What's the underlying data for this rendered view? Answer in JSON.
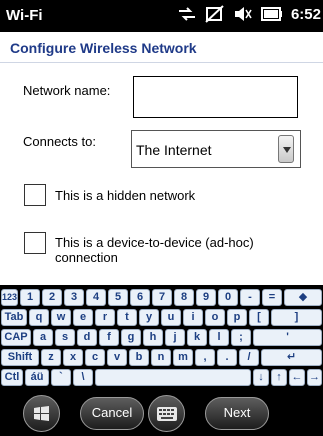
{
  "status_bar": {
    "title": "Wi-Fi",
    "time": "6:52"
  },
  "header": {
    "title": "Configure Wireless Network"
  },
  "form": {
    "network_name_label": "Network name:",
    "network_name_value": "",
    "connects_to_label": "Connects to:",
    "connects_to_value": "The Internet",
    "hidden_network_label": "This is a hidden network",
    "adhoc_label_line1": "This is a device-to-device (ad-hoc)",
    "adhoc_label_line2": "connection"
  },
  "keyboard": {
    "row1": [
      "123",
      "1",
      "2",
      "3",
      "4",
      "5",
      "6",
      "7",
      "8",
      "9",
      "0",
      "-",
      "=",
      "◆"
    ],
    "row2": [
      "Tab",
      "q",
      "w",
      "e",
      "r",
      "t",
      "y",
      "u",
      "i",
      "o",
      "p",
      "[",
      "]"
    ],
    "row3": [
      "CAP",
      "a",
      "s",
      "d",
      "f",
      "g",
      "h",
      "j",
      "k",
      "l",
      ";",
      "'"
    ],
    "row4": [
      "Shift",
      "z",
      "x",
      "c",
      "v",
      "b",
      "n",
      "m",
      ",",
      ".",
      "/",
      "↵"
    ],
    "row5": [
      "Ctl",
      "áü",
      "`",
      "\\",
      "",
      "↓",
      "↑",
      "←",
      "→"
    ]
  },
  "softkeys": {
    "cancel_label": "Cancel",
    "next_label": "Next"
  }
}
